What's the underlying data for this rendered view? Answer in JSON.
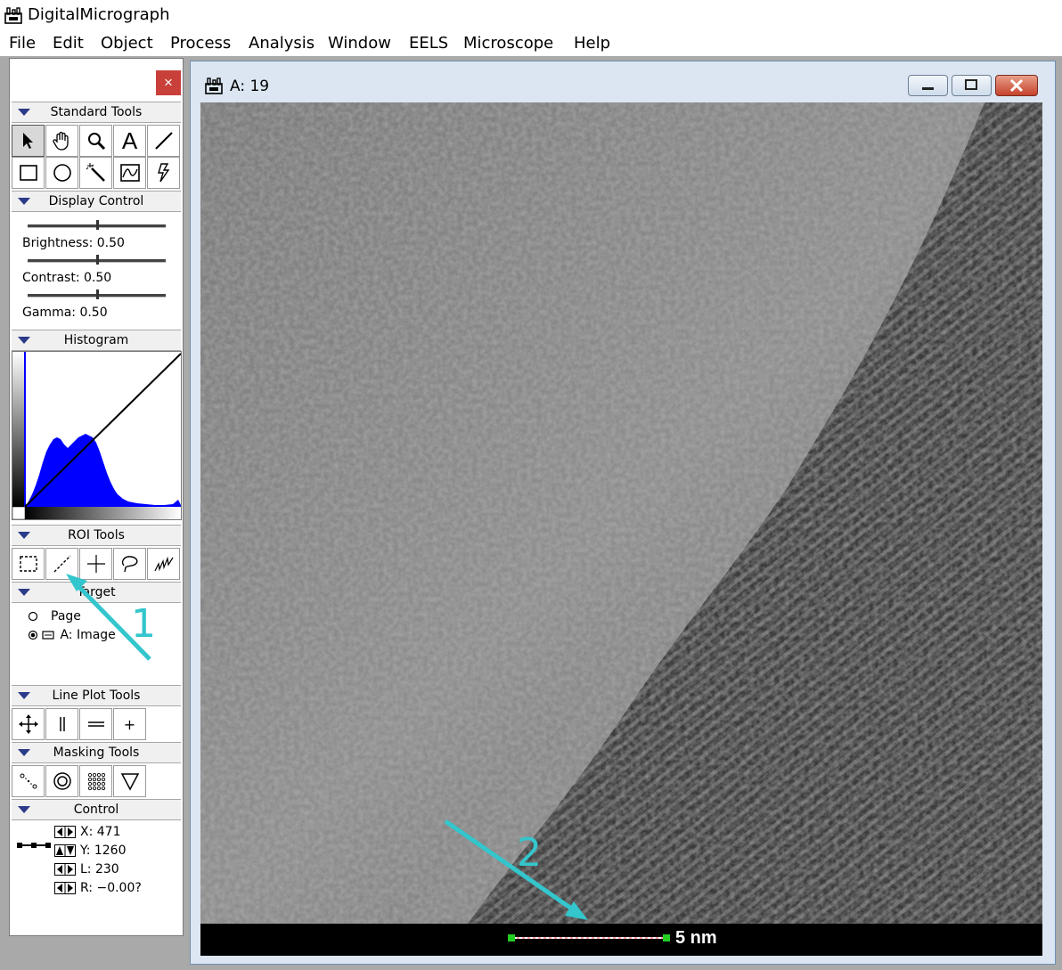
{
  "app": {
    "title": "DigitalMicrograph"
  },
  "menu": [
    "File",
    "Edit",
    "Object",
    "Process",
    "Analysis",
    "Window",
    "EELS",
    "Microscope",
    "Help"
  ],
  "palette": {
    "close_glyph": "×",
    "sections": {
      "standard_tools": "Standard Tools",
      "display_control": "Display Control",
      "histogram": "Histogram",
      "roi_tools": "ROI Tools",
      "target": "Target",
      "line_plot_tools": "Line Plot Tools",
      "masking_tools": "Masking Tools",
      "control": "Control"
    },
    "display_control": {
      "brightness_label": "Brightness: 0.50",
      "contrast_label": "Contrast: 0.50",
      "gamma_label": "Gamma: 0.50",
      "brightness": 0.5,
      "contrast": 0.5,
      "gamma": 0.5
    },
    "target": {
      "page": "Page",
      "image": "A: Image"
    },
    "control": {
      "x": "X: 471",
      "y": "Y: 1260",
      "l": "L: 230",
      "r": "R: −0.00?"
    },
    "line_plot_plus": "+",
    "text_tool_glyph": "A"
  },
  "image_window": {
    "title": "A: 19",
    "scale_label": "5 nm"
  },
  "annotations": {
    "one": "1",
    "two": "2",
    "color": "#33c6cc"
  },
  "colors": {
    "histogram": "#0000ff",
    "selected_tool": "#d8d8d8"
  }
}
